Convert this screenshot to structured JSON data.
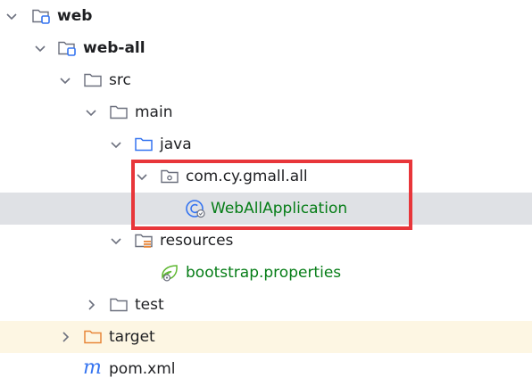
{
  "tree": {
    "web": {
      "label": "web",
      "icon": "module-folder-icon"
    },
    "web_all": {
      "label": "web-all",
      "icon": "module-folder-icon"
    },
    "src": {
      "label": "src",
      "icon": "folder-icon"
    },
    "main": {
      "label": "main",
      "icon": "folder-icon"
    },
    "java": {
      "label": "java",
      "icon": "source-root-folder-icon"
    },
    "package": {
      "label": "com.cy.gmall.all",
      "icon": "package-icon"
    },
    "class": {
      "label": "WebAllApplication",
      "icon": "spring-class-icon"
    },
    "resources": {
      "label": "resources",
      "icon": "resources-root-folder-icon"
    },
    "bootstrap": {
      "label": "bootstrap.properties",
      "icon": "spring-properties-icon"
    },
    "test": {
      "label": "test",
      "icon": "folder-icon"
    },
    "target": {
      "label": "target",
      "icon": "excluded-folder-icon"
    },
    "pom": {
      "label": "pom.xml",
      "icon_glyph": "m",
      "icon": "maven-icon"
    }
  },
  "colors": {
    "selection": "#dfe1e5",
    "excluded": "#fdf6e3",
    "highlight": "#e8363a",
    "green_text": "#067d17",
    "blue_icon": "#3574f0",
    "orange_icon": "#e8873a"
  }
}
